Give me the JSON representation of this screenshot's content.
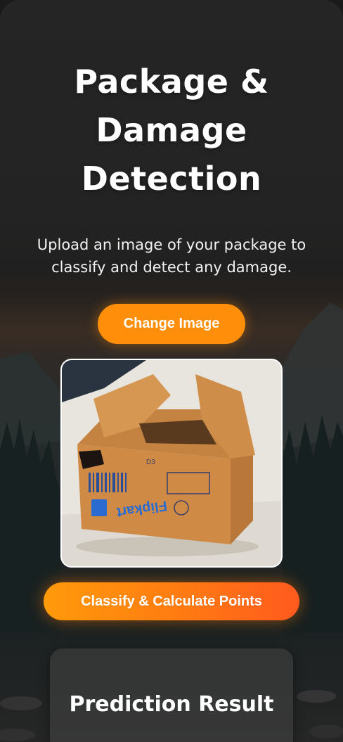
{
  "header": {
    "title": "Package & Damage Detection",
    "subtitle": "Upload an image of your package to classify and detect any damage."
  },
  "upload": {
    "change_label": "Change Image"
  },
  "preview": {
    "image_icon": "damaged-package-photo",
    "box_brand_text": "Flipkart",
    "box_code": "D3"
  },
  "actions": {
    "classify_label": "Classify & Calculate Points"
  },
  "result": {
    "title": "Prediction Result"
  },
  "colors": {
    "accent": "#ff8f0a",
    "accent_gradient_end": "#ff5a1e",
    "background": "#232323"
  }
}
